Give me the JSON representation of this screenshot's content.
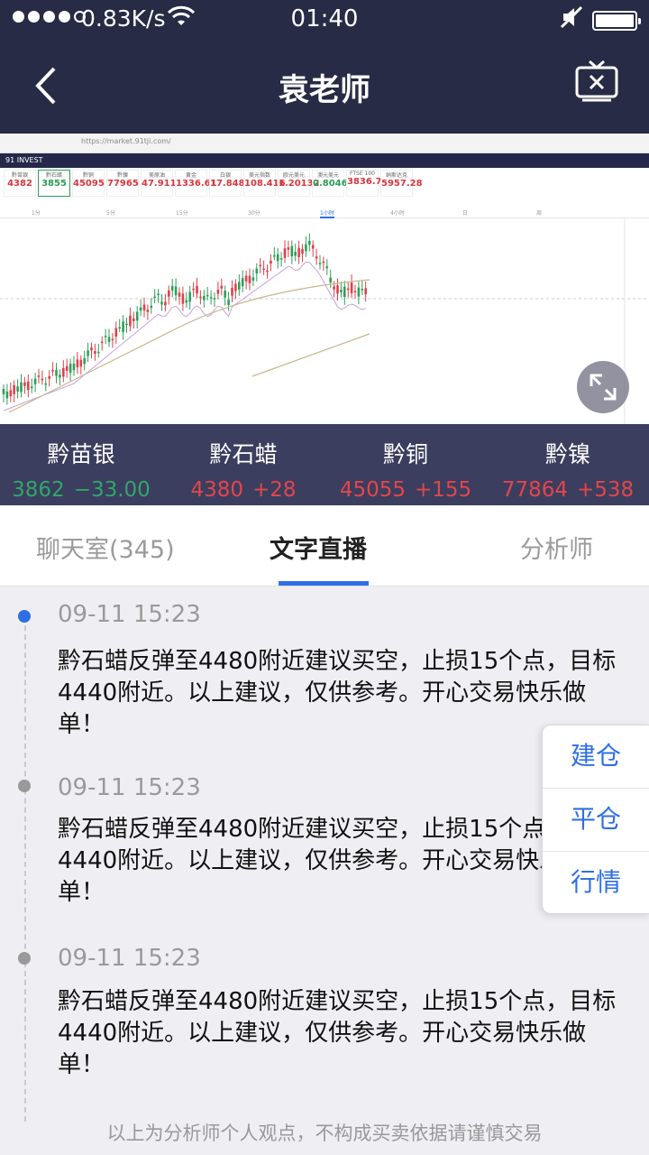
{
  "status_bar": {
    "network_speed": "0.83K/s",
    "time": "01:40"
  },
  "header": {
    "title": "袁老师"
  },
  "chart_preview": {
    "url": "https://market.91tji.com/",
    "brand": "91 INVEST",
    "quote_cells": [
      {
        "name": "黔苗银",
        "price": "4382"
      },
      {
        "name": "黔石蜡",
        "price": "3855"
      },
      {
        "name": "黔铜",
        "price": "45095"
      },
      {
        "name": "黔镍",
        "price": "77965"
      },
      {
        "name": "美原油",
        "price": "47.911"
      },
      {
        "name": "黄金",
        "price": "1336.61"
      },
      {
        "name": "白银",
        "price": "17.848"
      },
      {
        "name": "美元指数",
        "price": "108.416"
      },
      {
        "name": "欧元美元",
        "price": "1.20132"
      },
      {
        "name": "澳元美元",
        "price": "0.8046"
      },
      {
        "name": "FTSE 100",
        "price": "3836.7"
      },
      {
        "name": "纳斯达克",
        "price": "5957.28"
      }
    ],
    "periods": [
      "1分",
      "5分",
      "15分",
      "30分",
      "1小时",
      "4小时",
      "日",
      "周"
    ]
  },
  "ticker": [
    {
      "name": "黔苗银",
      "price": "3862",
      "change": "−33.00",
      "trend": "down"
    },
    {
      "name": "黔石蜡",
      "price": "4380",
      "change": "+28",
      "trend": "up"
    },
    {
      "name": "黔铜",
      "price": "45055",
      "change": "+155",
      "trend": "up"
    },
    {
      "name": "黔镍",
      "price": "77864",
      "change": "+538",
      "trend": "up"
    }
  ],
  "tabs": [
    {
      "label": "聊天室(345)"
    },
    {
      "label": "文字直播"
    },
    {
      "label": "分析师"
    }
  ],
  "entries": [
    {
      "time": "09-11 15:23",
      "text": "黔石蜡反弹至4480附近建议买空，止损15个点，目标4440附近。以上建议，仅供参考。开心交易快乐做单！"
    },
    {
      "time": "09-11 15:23",
      "text": "黔石蜡反弹至4480附近建议买空，止损15个点，目标4440附近。以上建议，仅供参考。开心交易快乐做单！"
    },
    {
      "time": "09-11 15:23",
      "text": "黔石蜡反弹至4480附近建议买空，止损15个点，目标4440附近。以上建议，仅供参考。开心交易快乐做单！"
    }
  ],
  "float_menu": [
    {
      "label": "建仓"
    },
    {
      "label": "平仓"
    },
    {
      "label": "行情"
    }
  ],
  "disclaimer": "以上为分析师个人观点，不构成买卖依据请谨慎交易",
  "colors": {
    "header_bg": "#272b45",
    "ticker_bg": "#3b3e5e",
    "up": "#e4454b",
    "down": "#31a66a",
    "accent": "#2f6fe5"
  }
}
